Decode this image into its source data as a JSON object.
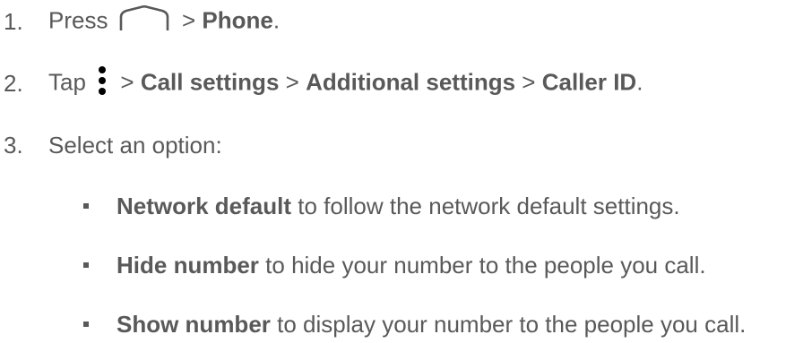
{
  "steps": [
    {
      "number": "1.",
      "before_icon": "Press",
      "icon": "home-icon",
      "sep": ">",
      "bold": "Phone",
      "end": "."
    },
    {
      "number": "2.",
      "before_icon": "Tap",
      "icon": "more-vertical-icon",
      "sep1": ">",
      "bold1": "Call settings",
      "sep2": ">",
      "bold2": "Additional settings",
      "sep3": ">",
      "bold3": "Caller ID",
      "end": "."
    },
    {
      "number": "3.",
      "text": "Select an option:"
    }
  ],
  "options": [
    {
      "bold": "Network default",
      "text": "to follow the network default settings."
    },
    {
      "bold": "Hide number",
      "text": "to hide your number to the people you call."
    },
    {
      "bold": "Show number",
      "text": "to display your number to the people you call."
    }
  ],
  "colors": {
    "text": "#595959",
    "background": "#ffffff"
  }
}
